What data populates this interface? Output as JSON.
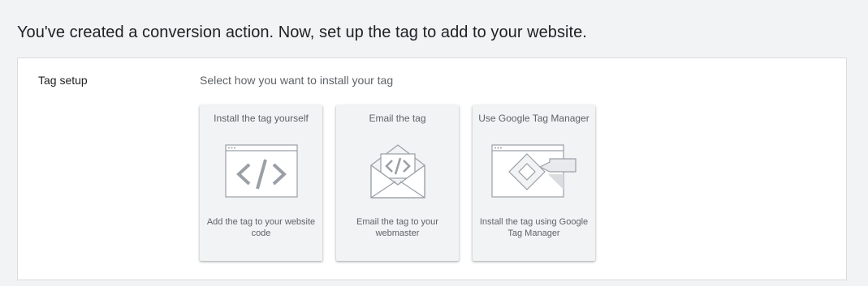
{
  "header": {
    "title": "You've created a conversion action. Now, set up the tag to add to your website."
  },
  "tag_setup": {
    "label": "Tag setup",
    "instructions": "Select how you want to install your tag",
    "options": [
      {
        "title": "Install the tag yourself",
        "description": "Add the tag to your website code",
        "icon": "code-window-icon"
      },
      {
        "title": "Email the tag",
        "description": "Email the tag to your webmaster",
        "icon": "email-code-icon"
      },
      {
        "title": "Use Google Tag Manager",
        "description": "Install the tag using Google Tag Manager",
        "icon": "tag-manager-icon"
      }
    ]
  },
  "colors": {
    "background": "#f1f3f4",
    "panel": "#ffffff",
    "card": "#f1f3f4",
    "text_primary": "#202124",
    "text_secondary": "#5f6368",
    "illustration_stroke": "#9aa0a6",
    "illustration_fill": "#ffffff"
  }
}
